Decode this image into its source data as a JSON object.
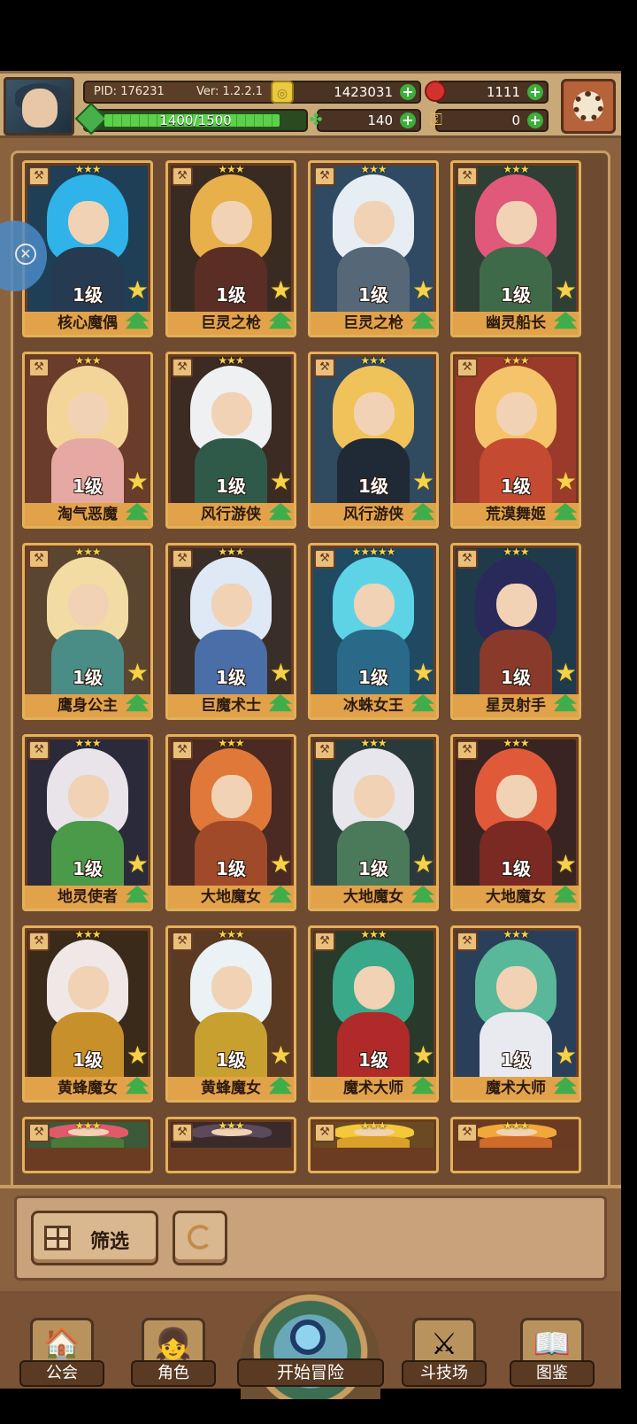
{
  "header": {
    "pid": "PID: 176231",
    "version": "Ver: 1.2.2.1",
    "gold": "1423031",
    "gems": "1111",
    "xp": "1400/1500",
    "xp_progress": 0.933,
    "clover": "140",
    "keys": "0"
  },
  "cards": [
    {
      "level": "1级",
      "name": "核心魔偶",
      "stars": "★★★",
      "colors": {
        "bg": "#1f3f57",
        "hair": "#2fb3e8",
        "body": "#263a52"
      }
    },
    {
      "level": "1级",
      "name": "巨灵之枪",
      "stars": "★★★",
      "colors": {
        "bg": "#3a2b22",
        "hair": "#e8b04a",
        "body": "#5a2e24"
      }
    },
    {
      "level": "1级",
      "name": "巨灵之枪",
      "stars": "★★★",
      "colors": {
        "bg": "#2f4a62",
        "hair": "#e6eef4",
        "body": "#566878"
      }
    },
    {
      "level": "1级",
      "name": "幽灵船长",
      "stars": "★★★",
      "colors": {
        "bg": "#2f3f36",
        "hair": "#e0587a",
        "body": "#3f6a4a"
      }
    },
    {
      "level": "1级",
      "name": "淘气恶魔",
      "stars": "★★★",
      "colors": {
        "bg": "#6a3c2c",
        "hair": "#f3d59a",
        "body": "#e5a8a2"
      }
    },
    {
      "level": "1级",
      "name": "风行游侠",
      "stars": "★★★",
      "colors": {
        "bg": "#3b2b22",
        "hair": "#eef0f2",
        "body": "#2f5a4a"
      }
    },
    {
      "level": "1级",
      "name": "风行游侠",
      "stars": "★★★",
      "colors": {
        "bg": "#304a5f",
        "hair": "#f0c25a",
        "body": "#1f2a36"
      }
    },
    {
      "level": "1级",
      "name": "荒漠舞姬",
      "stars": "★★★",
      "colors": {
        "bg": "#9a3a2a",
        "hair": "#f5c46a",
        "body": "#c44a32"
      }
    },
    {
      "level": "1级",
      "name": "鹰身公主",
      "stars": "★★★",
      "colors": {
        "bg": "#5a4630",
        "hair": "#f3dca4",
        "body": "#4a8c86"
      }
    },
    {
      "level": "1级",
      "name": "巨魔术士",
      "stars": "★★★",
      "colors": {
        "bg": "#3a2e28",
        "hair": "#dfe8f5",
        "body": "#4a6ea8"
      }
    },
    {
      "level": "1级",
      "name": "冰蛛女王",
      "stars": "★★★★★",
      "colors": {
        "bg": "#1f4a62",
        "hair": "#5fd3e6",
        "body": "#2a6a88"
      }
    },
    {
      "level": "1级",
      "name": "星灵射手",
      "stars": "★★★",
      "colors": {
        "bg": "#1f3a4a",
        "hair": "#2a2a5a",
        "body": "#8a3a2a"
      }
    },
    {
      "level": "1级",
      "name": "地灵使者",
      "stars": "★★★",
      "colors": {
        "bg": "#2a2a3a",
        "hair": "#e8e4ea",
        "body": "#4a9a4a"
      }
    },
    {
      "level": "1级",
      "name": "大地魔女",
      "stars": "★★★",
      "colors": {
        "bg": "#4a2a22",
        "hair": "#e0783a",
        "body": "#a04a2a"
      }
    },
    {
      "level": "1级",
      "name": "大地魔女",
      "stars": "★★★",
      "colors": {
        "bg": "#2a3a3a",
        "hair": "#e6e6ec",
        "body": "#4a7a5a"
      }
    },
    {
      "level": "1级",
      "name": "大地魔女",
      "stars": "★★★",
      "colors": {
        "bg": "#3a2422",
        "hair": "#e05a3a",
        "body": "#7a2a22"
      }
    },
    {
      "level": "1级",
      "name": "黄蜂魔女",
      "stars": "★★★",
      "colors": {
        "bg": "#3a2a1a",
        "hair": "#efe8e6",
        "body": "#c8902a"
      }
    },
    {
      "level": "1级",
      "name": "黄蜂魔女",
      "stars": "★★★",
      "colors": {
        "bg": "#5a3a22",
        "hair": "#eaf2f6",
        "body": "#c8a030"
      }
    },
    {
      "level": "1级",
      "name": "魔术大师",
      "stars": "★★★",
      "colors": {
        "bg": "#2a3a2a",
        "hair": "#3aa88a",
        "body": "#b02a2a"
      }
    },
    {
      "level": "1级",
      "name": "魔术大师",
      "stars": "★★★",
      "colors": {
        "bg": "#2a3f5a",
        "hair": "#5ab89a",
        "body": "#e8eaf0"
      }
    },
    {
      "level": "",
      "name": "",
      "stars": "★★★",
      "colors": {
        "bg": "#3a5a3a",
        "hair": "#e05a6a",
        "body": "#4a7a3a"
      }
    },
    {
      "level": "",
      "name": "",
      "stars": "★★★",
      "colors": {
        "bg": "#3a2a2a",
        "hair": "#5a4a5a",
        "body": "#3a2a2a"
      }
    },
    {
      "level": "",
      "name": "",
      "stars": "★★★",
      "colors": {
        "bg": "#6a4a22",
        "hair": "#f3c83a",
        "body": "#d9a02a"
      }
    },
    {
      "level": "",
      "name": "",
      "stars": "★★★",
      "colors": {
        "bg": "#6a3a22",
        "hair": "#f0a83a",
        "body": "#d06a2a"
      }
    }
  ],
  "controls": {
    "filter_label": "筛选"
  },
  "nav": {
    "guild": "公会",
    "character": "角色",
    "adventure": "开始冒险",
    "arena": "斗技场",
    "codex": "图鉴"
  }
}
